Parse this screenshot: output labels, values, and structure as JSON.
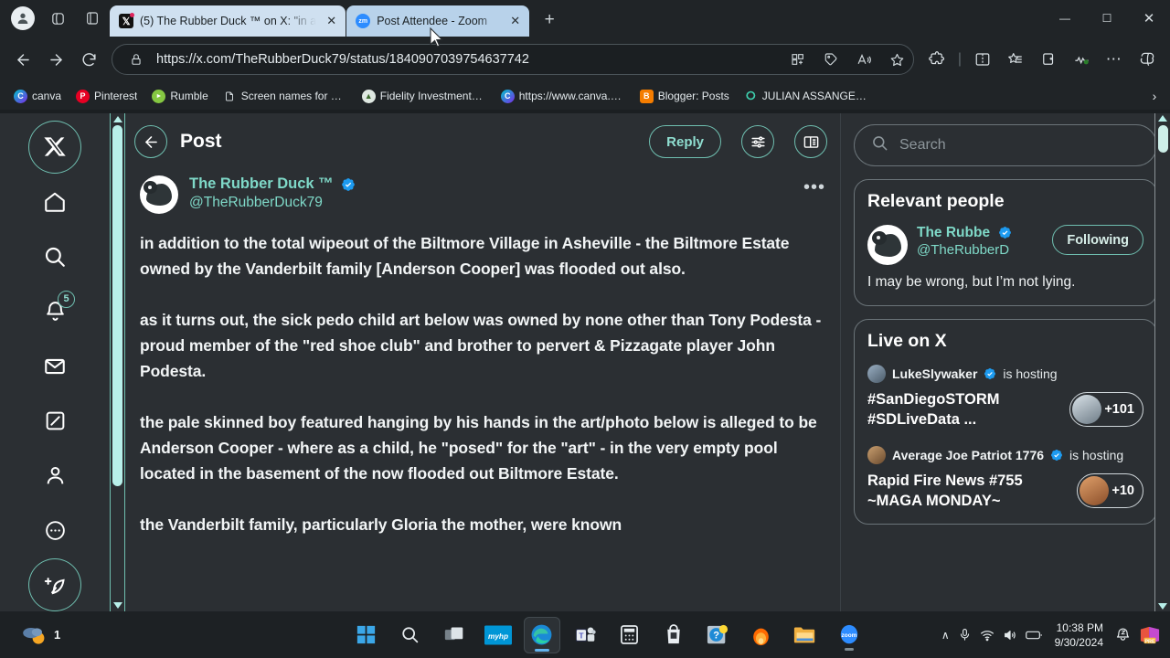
{
  "browser": {
    "tabstrip_icons": [
      "profile-avatar",
      "workspaces-icon",
      "tab-actions-icon"
    ],
    "tabs": [
      {
        "title": "(5) The Rubber Duck ™ on X: \"in a",
        "favicon": "x-logo-icon",
        "active": false
      },
      {
        "title": "Post Attendee - Zoom",
        "favicon": "zoom-icon",
        "active": true
      }
    ],
    "new_tab_label": "+",
    "window_controls": {
      "minimize": "—",
      "maximize": "☐",
      "close": "✕"
    },
    "nav": {
      "back": "←",
      "forward": "→",
      "refresh": "↻"
    },
    "omnibox": {
      "url": "https://x.com/TheRubberDuck79/status/1840907039754637742",
      "lock_icon": "lock-icon",
      "right_icons": [
        "split-screen-icon",
        "shopping-tag-icon",
        "read-aloud-icon",
        "favorite-star-icon"
      ]
    },
    "toolbar_icons": [
      "extensions-icon",
      "split-screen-icon",
      "favorites-icon",
      "collections-icon",
      "browser-essentials-icon",
      "settings-more-icon",
      "copilot-icon"
    ],
    "bookmarks": [
      {
        "label": "canva",
        "icon_color": "#8b3dff",
        "letter": "C"
      },
      {
        "label": "Pinterest",
        "icon_color": "#e60023",
        "letter": "P"
      },
      {
        "label": "Rumble",
        "icon_color": "#85c742",
        "letter": "▶"
      },
      {
        "label": "Screen names for all...",
        "icon_color": "#2b2f33",
        "letter": "☰"
      },
      {
        "label": "Fidelity Investments...",
        "icon_color": "#4f8a3d",
        "letter": "F"
      },
      {
        "label": "https://www.canva.c...",
        "icon_color": "#8b3dff",
        "letter": "C"
      },
      {
        "label": "Blogger: Posts",
        "icon_color": "#f57d00",
        "letter": "B"
      },
      {
        "label": "JULIAN ASSANGE P...",
        "icon_color": "#2b2f33",
        "letter": "○"
      }
    ],
    "bookmarks_overflow": "›"
  },
  "colors": {
    "page_bg": "#2b2f33",
    "accent_teal": "#7fd9c8",
    "border_teal": "#6fbfb0",
    "scrollbar_thumb": "#b8f0ea",
    "verified_blue": "#1d9bf0"
  },
  "x_app": {
    "nav_items": [
      {
        "name": "x-logo-icon",
        "label": "X"
      },
      {
        "name": "home-icon",
        "label": "Home"
      },
      {
        "name": "search-icon",
        "label": "Explore"
      },
      {
        "name": "notifications-bell-icon",
        "label": "Notifications",
        "badge": "5"
      },
      {
        "name": "messages-envelope-icon",
        "label": "Messages"
      },
      {
        "name": "grok-icon",
        "label": "Grok"
      },
      {
        "name": "profile-person-icon",
        "label": "Profile"
      },
      {
        "name": "more-circle-icon",
        "label": "More"
      },
      {
        "name": "compose-post-icon",
        "label": "Post"
      }
    ],
    "header": {
      "back_label": "←",
      "title": "Post",
      "reply_label": "Reply",
      "settings_icon": "sliders-icon",
      "reader_icon": "book-reader-icon"
    },
    "post": {
      "author_name": "The Rubber Duck ™",
      "handle": "@TheRubberDuck79",
      "verified": true,
      "more_label": "•••",
      "paragraphs": [
        "in addition to the total wipeout of the Biltmore Village in Asheville - the Biltmore Estate owned by the Vanderbilt family [Anderson Cooper] was flooded out also.",
        "as it turns out, the sick pedo child art below was owned by none other than Tony Podesta - proud member of the \"red shoe club\" and brother to pervert & Pizzagate player John Podesta.",
        "the pale skinned boy featured hanging by his hands in the art/photo below is alleged to be Anderson Cooper - where as a child, he \"posed\" for the \"art\" - in the very empty pool located in the basement of the now flooded out Biltmore Estate.",
        "the Vanderbilt family, particularly Gloria the mother, were known"
      ]
    },
    "sidebar": {
      "search_placeholder": "Search",
      "relevant_people": {
        "title": "Relevant people",
        "person": {
          "name": "The Rubbe",
          "handle": "@TheRubberD",
          "verified": true,
          "follow_label": "Following",
          "bio": "I may be wrong, but I’m not lying."
        }
      },
      "live_on_x": {
        "title": "Live on X",
        "spaces": [
          {
            "host": "LukeSlywaker",
            "verified": true,
            "hosting_label": "is hosting",
            "topic": "#SanDiegoSTORM #SDLiveData ...",
            "listeners": "+101"
          },
          {
            "host": "Average Joe Patriot 1776",
            "verified": true,
            "hosting_label": "is hosting",
            "topic": "Rapid Fire News #755 ~MAGA MONDAY~",
            "listeners": "+10"
          }
        ]
      }
    }
  },
  "taskbar": {
    "weather_badge": "1",
    "items": [
      {
        "name": "start-button",
        "label": "Start"
      },
      {
        "name": "taskbar-search-icon",
        "label": "Search"
      },
      {
        "name": "task-view-icon",
        "label": "Task View"
      },
      {
        "name": "myhp-icon",
        "label": "myHP"
      },
      {
        "name": "edge-icon",
        "label": "Microsoft Edge"
      },
      {
        "name": "teams-icon",
        "label": "Microsoft Teams"
      },
      {
        "name": "calculator-icon",
        "label": "Calculator"
      },
      {
        "name": "store-icon",
        "label": "Microsoft Store"
      },
      {
        "name": "help-icon",
        "label": "Get Help"
      },
      {
        "name": "firefox-icon",
        "label": "Firefox"
      },
      {
        "name": "file-explorer-icon",
        "label": "File Explorer"
      },
      {
        "name": "zoom-icon",
        "label": "Zoom"
      }
    ],
    "tray": {
      "chevron": "∧",
      "mic_icon": "microphone-icon",
      "wifi_icon": "wifi-icon",
      "volume_icon": "volume-icon",
      "battery_icon": "battery-icon",
      "time": "10:38 PM",
      "date": "9/30/2024",
      "notification_icon": "do-not-disturb-icon",
      "office_icon": "office-pre-icon"
    }
  }
}
